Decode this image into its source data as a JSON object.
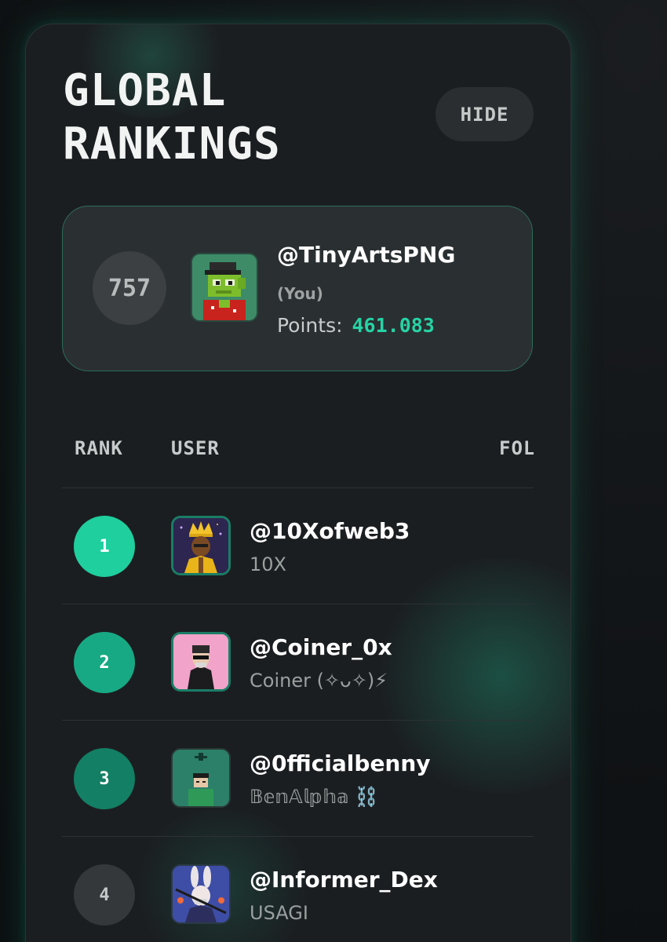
{
  "header": {
    "title_line1": "GLOBAL",
    "title_line2": "RANKINGS",
    "hide_label": "HIDE"
  },
  "you": {
    "rank": "757",
    "handle": "@TinyArtsPNG",
    "tag": "(You)",
    "points_label": "Points:",
    "points_value": "461.083"
  },
  "table": {
    "columns": [
      "RANK",
      "USER",
      "FOLLOWERS"
    ],
    "rows": [
      {
        "rank": "1",
        "handle": "@10Xofweb3",
        "name": "10X",
        "rank_color": "#1fcf9e"
      },
      {
        "rank": "2",
        "handle": "@Coiner_0x",
        "name": "Coiner (✧ᴗ✧)⚡",
        "rank_color": "#17a983"
      },
      {
        "rank": "3",
        "handle": "@0fficialbenny",
        "name": "𝔹𝕖𝕟𝔸𝕝𝕡𝕙𝕒 ⛓️",
        "rank_color": "#137f64"
      },
      {
        "rank": "4",
        "handle": "@Informer_Dex",
        "name": "USAGI",
        "rank_color": "#34383b"
      }
    ]
  },
  "colors": {
    "accent": "#26d3a4",
    "panel": "#1b1e21",
    "card": "#2a2f32"
  },
  "icons": {
    "you_avatar": "pixel-frog-avatar-icon",
    "row_1_avatar": "crowned-king-avatar-icon",
    "row_2_avatar": "masked-hoodie-avatar-icon",
    "row_3_avatar": "green-pixel-avatar-icon",
    "row_4_avatar": "rabbit-warrior-avatar-icon"
  }
}
